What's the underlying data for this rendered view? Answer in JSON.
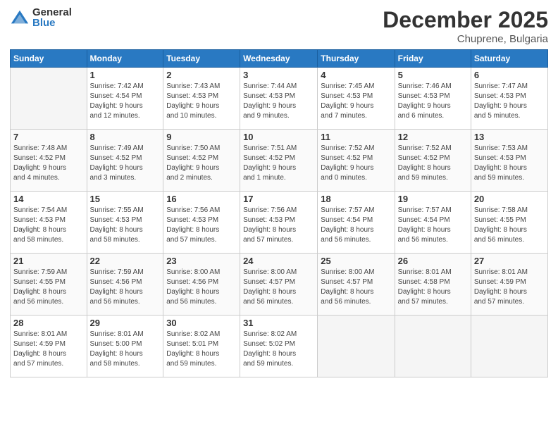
{
  "logo": {
    "general": "General",
    "blue": "Blue"
  },
  "title": "December 2025",
  "location": "Chuprene, Bulgaria",
  "headers": [
    "Sunday",
    "Monday",
    "Tuesday",
    "Wednesday",
    "Thursday",
    "Friday",
    "Saturday"
  ],
  "weeks": [
    [
      {
        "day": "",
        "info": ""
      },
      {
        "day": "1",
        "info": "Sunrise: 7:42 AM\nSunset: 4:54 PM\nDaylight: 9 hours\nand 12 minutes."
      },
      {
        "day": "2",
        "info": "Sunrise: 7:43 AM\nSunset: 4:53 PM\nDaylight: 9 hours\nand 10 minutes."
      },
      {
        "day": "3",
        "info": "Sunrise: 7:44 AM\nSunset: 4:53 PM\nDaylight: 9 hours\nand 9 minutes."
      },
      {
        "day": "4",
        "info": "Sunrise: 7:45 AM\nSunset: 4:53 PM\nDaylight: 9 hours\nand 7 minutes."
      },
      {
        "day": "5",
        "info": "Sunrise: 7:46 AM\nSunset: 4:53 PM\nDaylight: 9 hours\nand 6 minutes."
      },
      {
        "day": "6",
        "info": "Sunrise: 7:47 AM\nSunset: 4:53 PM\nDaylight: 9 hours\nand 5 minutes."
      }
    ],
    [
      {
        "day": "7",
        "info": "Sunrise: 7:48 AM\nSunset: 4:52 PM\nDaylight: 9 hours\nand 4 minutes."
      },
      {
        "day": "8",
        "info": "Sunrise: 7:49 AM\nSunset: 4:52 PM\nDaylight: 9 hours\nand 3 minutes."
      },
      {
        "day": "9",
        "info": "Sunrise: 7:50 AM\nSunset: 4:52 PM\nDaylight: 9 hours\nand 2 minutes."
      },
      {
        "day": "10",
        "info": "Sunrise: 7:51 AM\nSunset: 4:52 PM\nDaylight: 9 hours\nand 1 minute."
      },
      {
        "day": "11",
        "info": "Sunrise: 7:52 AM\nSunset: 4:52 PM\nDaylight: 9 hours\nand 0 minutes."
      },
      {
        "day": "12",
        "info": "Sunrise: 7:52 AM\nSunset: 4:52 PM\nDaylight: 8 hours\nand 59 minutes."
      },
      {
        "day": "13",
        "info": "Sunrise: 7:53 AM\nSunset: 4:53 PM\nDaylight: 8 hours\nand 59 minutes."
      }
    ],
    [
      {
        "day": "14",
        "info": "Sunrise: 7:54 AM\nSunset: 4:53 PM\nDaylight: 8 hours\nand 58 minutes."
      },
      {
        "day": "15",
        "info": "Sunrise: 7:55 AM\nSunset: 4:53 PM\nDaylight: 8 hours\nand 58 minutes."
      },
      {
        "day": "16",
        "info": "Sunrise: 7:56 AM\nSunset: 4:53 PM\nDaylight: 8 hours\nand 57 minutes."
      },
      {
        "day": "17",
        "info": "Sunrise: 7:56 AM\nSunset: 4:53 PM\nDaylight: 8 hours\nand 57 minutes."
      },
      {
        "day": "18",
        "info": "Sunrise: 7:57 AM\nSunset: 4:54 PM\nDaylight: 8 hours\nand 56 minutes."
      },
      {
        "day": "19",
        "info": "Sunrise: 7:57 AM\nSunset: 4:54 PM\nDaylight: 8 hours\nand 56 minutes."
      },
      {
        "day": "20",
        "info": "Sunrise: 7:58 AM\nSunset: 4:55 PM\nDaylight: 8 hours\nand 56 minutes."
      }
    ],
    [
      {
        "day": "21",
        "info": "Sunrise: 7:59 AM\nSunset: 4:55 PM\nDaylight: 8 hours\nand 56 minutes."
      },
      {
        "day": "22",
        "info": "Sunrise: 7:59 AM\nSunset: 4:56 PM\nDaylight: 8 hours\nand 56 minutes."
      },
      {
        "day": "23",
        "info": "Sunrise: 8:00 AM\nSunset: 4:56 PM\nDaylight: 8 hours\nand 56 minutes."
      },
      {
        "day": "24",
        "info": "Sunrise: 8:00 AM\nSunset: 4:57 PM\nDaylight: 8 hours\nand 56 minutes."
      },
      {
        "day": "25",
        "info": "Sunrise: 8:00 AM\nSunset: 4:57 PM\nDaylight: 8 hours\nand 56 minutes."
      },
      {
        "day": "26",
        "info": "Sunrise: 8:01 AM\nSunset: 4:58 PM\nDaylight: 8 hours\nand 57 minutes."
      },
      {
        "day": "27",
        "info": "Sunrise: 8:01 AM\nSunset: 4:59 PM\nDaylight: 8 hours\nand 57 minutes."
      }
    ],
    [
      {
        "day": "28",
        "info": "Sunrise: 8:01 AM\nSunset: 4:59 PM\nDaylight: 8 hours\nand 57 minutes."
      },
      {
        "day": "29",
        "info": "Sunrise: 8:01 AM\nSunset: 5:00 PM\nDaylight: 8 hours\nand 58 minutes."
      },
      {
        "day": "30",
        "info": "Sunrise: 8:02 AM\nSunset: 5:01 PM\nDaylight: 8 hours\nand 59 minutes."
      },
      {
        "day": "31",
        "info": "Sunrise: 8:02 AM\nSunset: 5:02 PM\nDaylight: 8 hours\nand 59 minutes."
      },
      {
        "day": "",
        "info": ""
      },
      {
        "day": "",
        "info": ""
      },
      {
        "day": "",
        "info": ""
      }
    ]
  ]
}
